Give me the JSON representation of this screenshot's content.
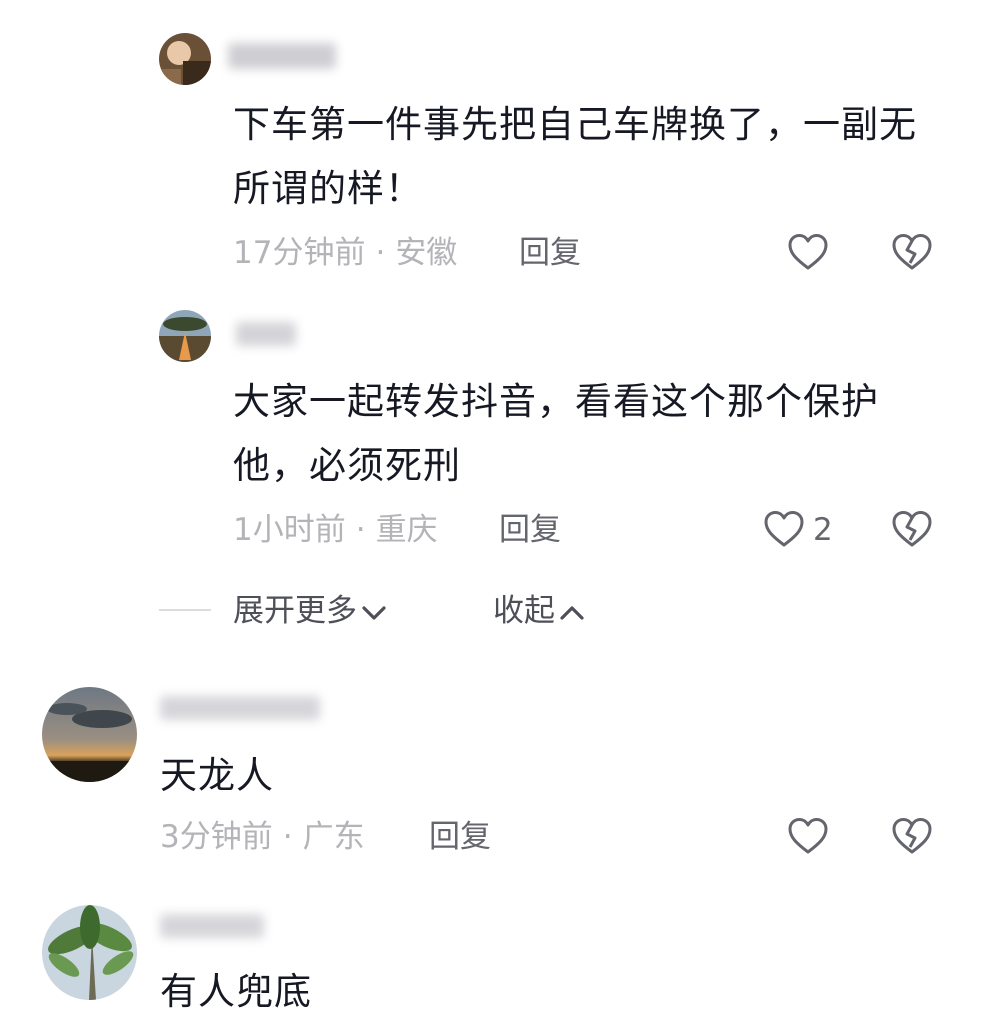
{
  "comments": [
    {
      "text": "下车第一件事先把自己车牌换了，一副无所谓的样！",
      "time": "17分钟前",
      "location": "安徽",
      "reply_label": "回复",
      "likes": ""
    },
    {
      "text": "大家一起转发抖音，看看这个那个保护他，必须死刑",
      "time": "1小时前",
      "location": "重庆",
      "reply_label": "回复",
      "likes": "2"
    },
    {
      "text": "天龙人",
      "time": "3分钟前",
      "location": "广东",
      "reply_label": "回复",
      "likes": ""
    },
    {
      "text": "有人兜底",
      "time": "",
      "location": "",
      "reply_label": "",
      "likes": ""
    }
  ],
  "thread": {
    "expand_label": "展开更多",
    "collapse_label": "收起"
  },
  "separator": "·",
  "icons": {
    "like": "heart-outline-icon",
    "dislike": "broken-heart-icon",
    "expand": "chevron-down-icon",
    "collapse": "chevron-up-icon"
  },
  "colors": {
    "text": "#161823",
    "meta": "#b4b4b8",
    "action": "#64656d"
  }
}
